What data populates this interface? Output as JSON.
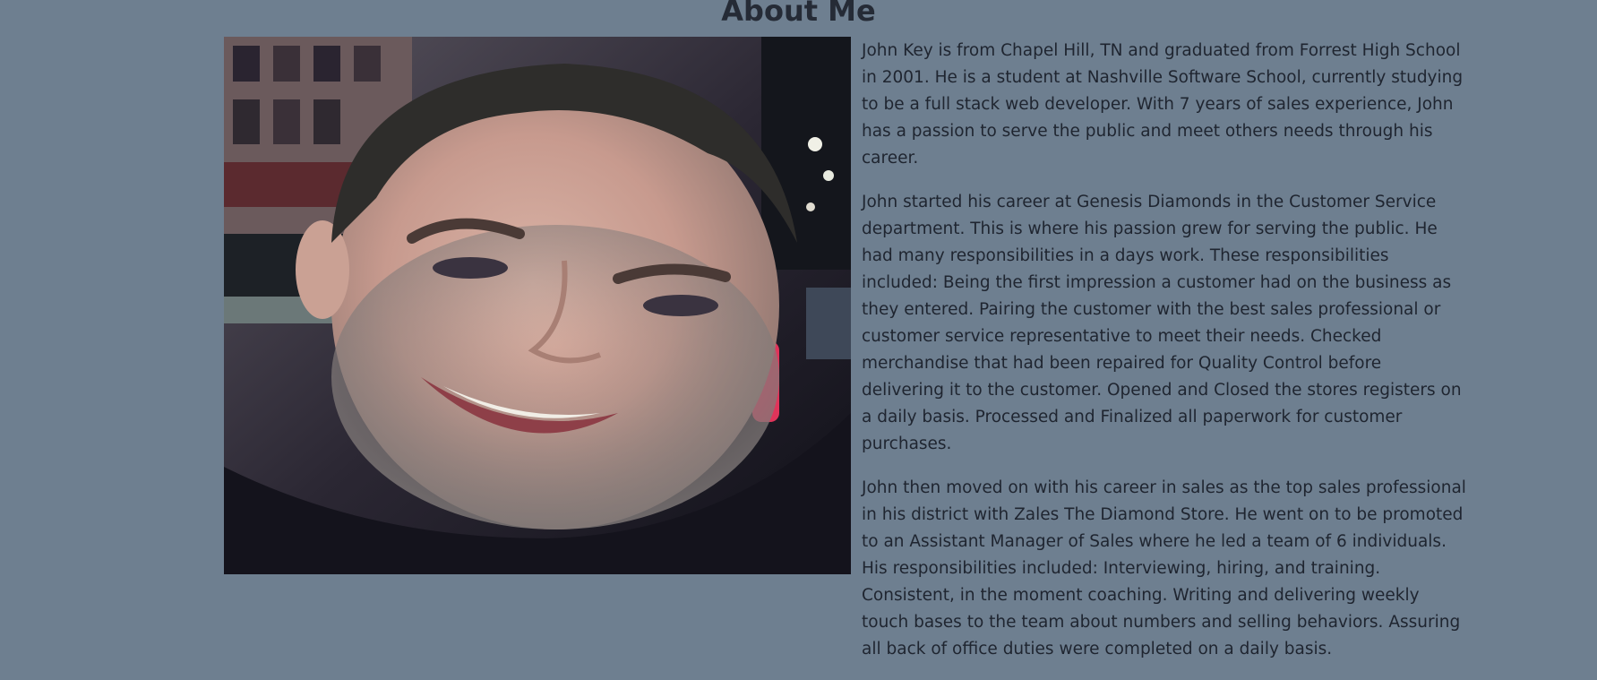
{
  "page": {
    "title": "About Me"
  },
  "profile": {
    "photo_alt": "Portrait photo of John Key",
    "paragraphs": [
      "John Key is from Chapel Hill, TN and graduated from Forrest High School in 2001. He is a student at Nashville Software School, currently studying to be a full stack web developer. With 7 years of sales experience, John has a passion to serve the public and meet others needs through his career.",
      "John started his career at Genesis Diamonds in the Customer Service department. This is where his passion grew for serving the public. He had many responsibilities in a days work. These responsibilities included: Being the first impression a customer had on the business as they entered. Pairing the customer with the best sales professional or customer service representative to meet their needs. Checked merchandise that had been repaired for Quality Control before delivering it to the customer. Opened and Closed the stores registers on a daily basis. Processed and Finalized all paperwork for customer purchases.",
      "John then moved on with his career in sales as the top sales professional in his district with Zales The Diamond Store. He went on to be promoted to an Assistant Manager of Sales where he led a team of 6 individuals. His responsibilities included: Interviewing, hiring, and training. Consistent, in the moment coaching. Writing and delivering weekly touch bases to the team about numbers and selling behaviors. Assuring all back of office duties were completed on a daily basis."
    ]
  },
  "colors": {
    "background": "#6e7f90",
    "text": "#1f2530"
  }
}
